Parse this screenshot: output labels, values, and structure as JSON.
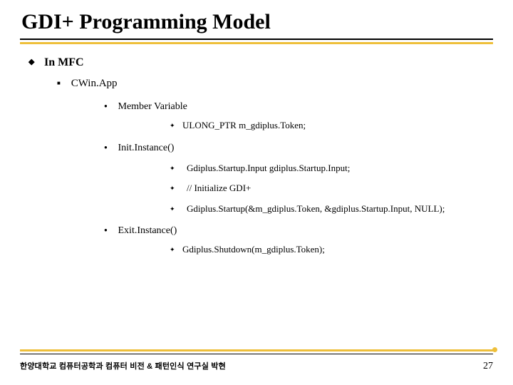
{
  "title": "GDI+ Programming Model",
  "bullets": {
    "lvl1": "In MFC",
    "lvl2": "CWin.App",
    "memberVar": {
      "label": "Member Variable",
      "item": "ULONG_PTR m_gdiplus.Token;"
    },
    "initInstance": {
      "label": "Init.Instance()",
      "i1": "Gdiplus.Startup.Input gdiplus.Startup.Input;",
      "i2": "// Initialize GDI+",
      "i3": "Gdiplus.Startup(&m_gdiplus.Token, &gdiplus.Startup.Input, NULL);"
    },
    "exitInstance": {
      "label": "Exit.Instance()",
      "i1": "Gdiplus.Shutdown(m_gdiplus.Token);"
    }
  },
  "footer": {
    "org": "한양대학교 컴퓨터공학과   컴퓨터 비전 & 패턴인식 연구실     박현",
    "page": "27"
  }
}
